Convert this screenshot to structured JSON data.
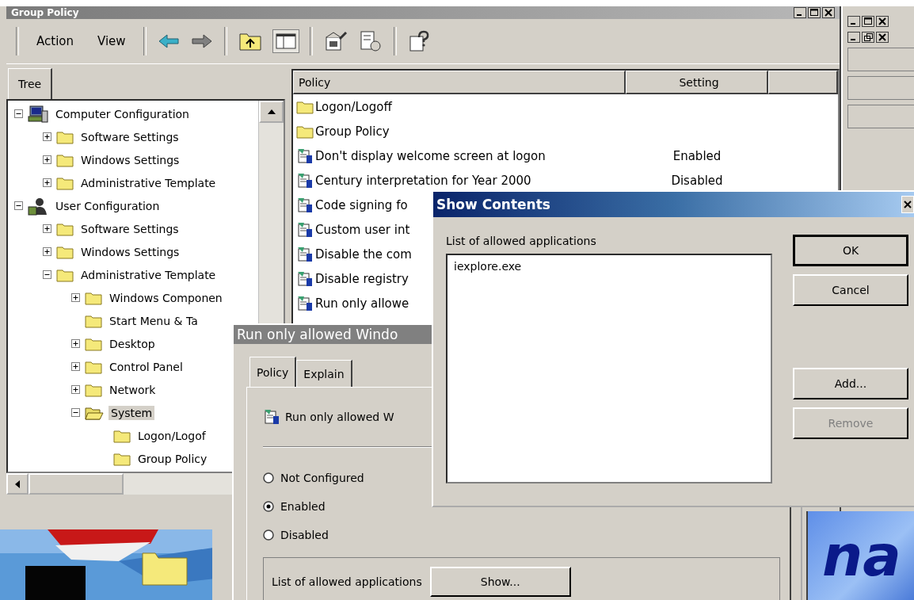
{
  "main_window": {
    "title": "Group Policy",
    "menu": [
      "Action",
      "View"
    ],
    "tree_tab": "Tree",
    "tree": [
      {
        "label": "Computer Configuration",
        "kind": "computer",
        "expanded": true,
        "selected": false,
        "children": [
          {
            "label": "Software Settings",
            "kind": "folder",
            "expanded": false,
            "selected": false
          },
          {
            "label": "Windows Settings",
            "kind": "folder",
            "expanded": false,
            "selected": false
          },
          {
            "label": "Administrative Template",
            "kind": "folder",
            "expanded": false,
            "selected": false
          }
        ]
      },
      {
        "label": "User Configuration",
        "kind": "user",
        "expanded": true,
        "selected": false,
        "children": [
          {
            "label": "Software Settings",
            "kind": "folder",
            "expanded": false,
            "selected": false
          },
          {
            "label": "Windows Settings",
            "kind": "folder",
            "expanded": false,
            "selected": false
          },
          {
            "label": "Administrative Template",
            "kind": "folder",
            "expanded": true,
            "selected": false,
            "children": [
              {
                "label": "Windows Componen",
                "kind": "folder",
                "expanded": false,
                "selected": false
              },
              {
                "label": "Start Menu & Ta",
                "kind": "folder",
                "selected": false
              },
              {
                "label": "Desktop",
                "kind": "folder",
                "expanded": false,
                "selected": false
              },
              {
                "label": "Control Panel",
                "kind": "folder",
                "expanded": false,
                "selected": false
              },
              {
                "label": "Network",
                "kind": "folder",
                "expanded": false,
                "selected": false
              },
              {
                "label": "System",
                "kind": "open-folder",
                "expanded": true,
                "selected": true,
                "children": [
                  {
                    "label": "Logon/Logof",
                    "kind": "folder",
                    "selected": false
                  },
                  {
                    "label": "Group Policy",
                    "kind": "folder",
                    "selected": false
                  }
                ]
              }
            ]
          }
        ]
      }
    ],
    "list": {
      "columns": [
        "Policy",
        "Setting"
      ],
      "rows": [
        {
          "kind": "folder",
          "policy": "Logon/Logoff"
        },
        {
          "kind": "folder",
          "policy": "Group Policy"
        },
        {
          "kind": "policy",
          "policy": "Don't display welcome screen at logon",
          "setting": "Enabled"
        },
        {
          "kind": "policy",
          "policy": "Century interpretation for Year 2000",
          "setting": "Disabled"
        },
        {
          "kind": "policy",
          "policy": "Code signing fo"
        },
        {
          "kind": "policy",
          "policy": "Custom user int"
        },
        {
          "kind": "policy",
          "policy": "Disable the com"
        },
        {
          "kind": "policy",
          "policy": "Disable registry"
        },
        {
          "kind": "policy",
          "policy": "Run only allowe"
        }
      ]
    }
  },
  "policy_dialog": {
    "title": "Run only allowed Windo",
    "tabs": [
      {
        "label": "Policy",
        "selected": true
      },
      {
        "label": "Explain",
        "selected": false
      }
    ],
    "policy_name": "Run only allowed W",
    "options": [
      {
        "label": "Not Configured",
        "selected": false
      },
      {
        "label": "Enabled",
        "selected": true
      },
      {
        "label": "Disabled",
        "selected": false
      }
    ],
    "list_label": "List of allowed applications",
    "show_button": "Show..."
  },
  "show_dialog": {
    "title": "Show Contents",
    "list_label": "List of allowed applications",
    "items": [
      "iexplore.exe"
    ],
    "buttons": [
      {
        "label": "OK",
        "kind": "default",
        "disabled": false
      },
      {
        "label": "Cancel",
        "kind": "normal",
        "disabled": false
      },
      {
        "label": "Add...",
        "kind": "spaced",
        "disabled": false
      },
      {
        "label": "Remove",
        "kind": "normal",
        "disabled": true
      }
    ]
  },
  "background_text": "na"
}
